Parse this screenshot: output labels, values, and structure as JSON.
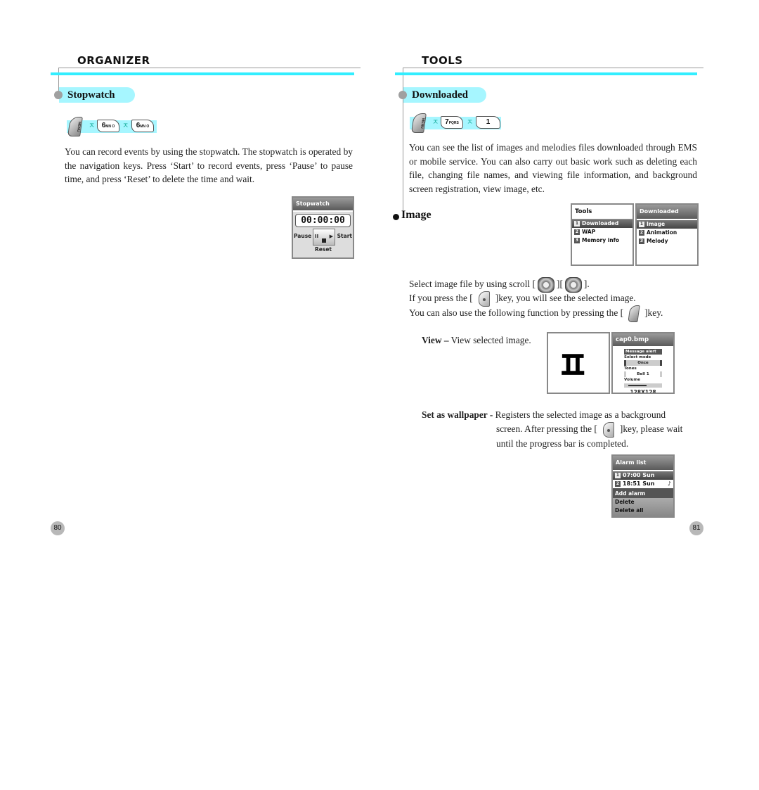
{
  "left_page": {
    "section_title": "ORGANIZER",
    "subsection": "Stopwatch",
    "key_sequence": [
      {
        "icon": "menu-key",
        "label": "MENU"
      },
      {
        "icon": "arrow-separator",
        "label": "ㅈ"
      },
      {
        "icon": "number-key",
        "label": "6MNO"
      },
      {
        "icon": "arrow-separator",
        "label": "ㅈ"
      },
      {
        "icon": "number-key",
        "label": "6MNO"
      }
    ],
    "key_labels": {
      "k1": "6",
      "k1_sub": "MN O",
      "k2": "6",
      "k2_sub": "MN O",
      "sep": "ㅈ",
      "menu": "MENU"
    },
    "body_text": "You can record events by using the stopwatch. The stopwatch is operated by the navigation keys. Press ‘Start’ to record events, press ‘Pause’ to pause time, and press ‘Reset’ to delete the time and wait.",
    "stopwatch_screen": {
      "title": "Stopwatch",
      "time": "00:00:00",
      "left_label": "Pause",
      "right_label": "Start",
      "bottom_label": "Reset"
    },
    "page_number": "80"
  },
  "right_page": {
    "section_title": "TOOLS",
    "subsection": "Downloaded",
    "key_labels": {
      "k1": "7",
      "k1_sub": "PQRS",
      "k2": "1",
      "sep": "ㅈ",
      "menu": "MENU"
    },
    "body_text": "You can see the list of images and melodies files downloaded through EMS or mobile service. You can also carry out basic work such as deleting each file, changing file names, and viewing file information, and background screen registration, view image, etc.",
    "image_heading": "Image",
    "tools_screen": {
      "title": "Tools",
      "items": [
        {
          "num": "1",
          "label": "Downloaded",
          "selected": true
        },
        {
          "num": "2",
          "label": "WAP",
          "selected": false
        },
        {
          "num": "3",
          "label": "Memory info",
          "selected": false
        }
      ]
    },
    "downloaded_screen": {
      "title": "Downloaded",
      "items": [
        {
          "num": "1",
          "label": "Image",
          "selected": true
        },
        {
          "num": "2",
          "label": "Animation",
          "selected": false
        },
        {
          "num": "3",
          "label": "Melody",
          "selected": false
        }
      ]
    },
    "instructions": {
      "line1_a": "Select image file by using scroll [",
      "line1_b": "][",
      "line1_c": "].",
      "line2_a": "If you press the [",
      "line2_b": "]key, you will see the selected image.",
      "line3_a": "You can also use the following function by pressing the [",
      "line3_b": "]key."
    },
    "view": {
      "term": "View –",
      "desc": " View selected image.",
      "preview_glyph": "ㅍㅔ"
    },
    "cap_screen": {
      "title": "cap0.bmp",
      "message_alert": "Message alert",
      "select_mode": "Select mode",
      "mode_value": "Once",
      "tones": "Tones",
      "tone_value": "Bell 1",
      "volume": "Volume",
      "volume_level": 0.6,
      "resolution": "128X128"
    },
    "wallpaper": {
      "term": "Set as wallpaper -",
      "line1": " Registers the selected image as a background",
      "line2_a": "screen. After pressing the [",
      "line2_b": "]key, please wait",
      "line3": "until the progress bar is completed."
    },
    "alarm_screen": {
      "title": "Alarm list",
      "items": [
        {
          "num": "1",
          "label": "07:00 Sun"
        },
        {
          "num": "2",
          "label": "18:51 Sun"
        }
      ],
      "menu": [
        "Add alarm",
        "Delete",
        "Delete all"
      ]
    },
    "page_number": "81"
  }
}
